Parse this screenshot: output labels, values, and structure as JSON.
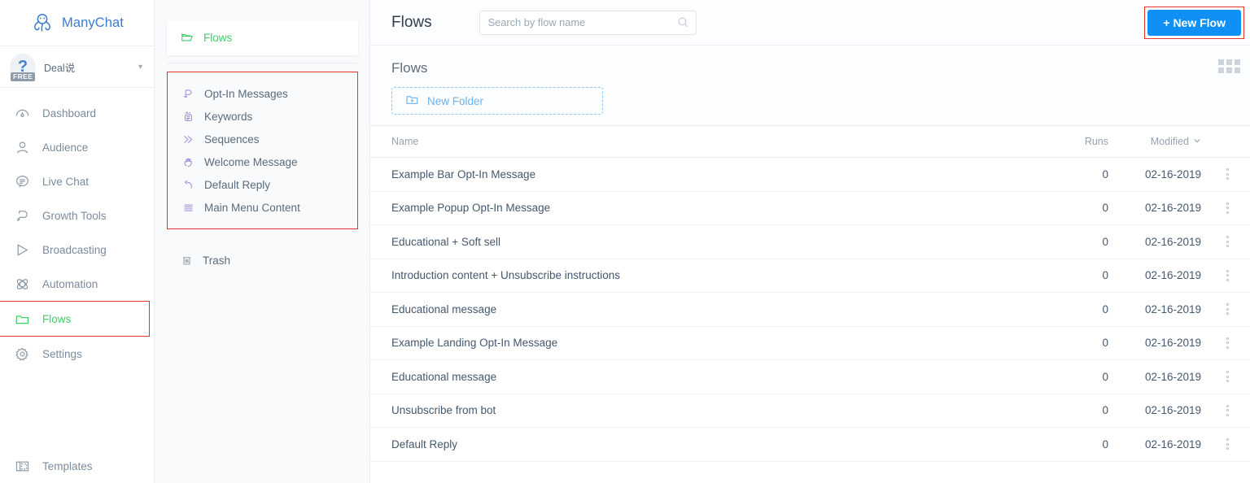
{
  "brand": {
    "name": "ManyChat",
    "logo_icon": "manychat-octopus-logo"
  },
  "account": {
    "name": "Deal说",
    "plan_badge": "FREE",
    "avatar_icon": "user-avatar",
    "chevron_icon": "chevron-down-icon"
  },
  "sidebar": {
    "items": [
      {
        "label": "Dashboard",
        "icon": "dashboard-icon",
        "active": false
      },
      {
        "label": "Audience",
        "icon": "person-icon",
        "active": false
      },
      {
        "label": "Live Chat",
        "icon": "chat-bubble-icon",
        "active": false
      },
      {
        "label": "Growth Tools",
        "icon": "magnet-icon",
        "active": false
      },
      {
        "label": "Broadcasting",
        "icon": "send-icon",
        "active": false
      },
      {
        "label": "Automation",
        "icon": "atom-icon",
        "active": false
      },
      {
        "label": "Flows",
        "icon": "folder-icon",
        "active": true
      },
      {
        "label": "Settings",
        "icon": "gear-icon",
        "active": false
      }
    ],
    "bottom_item": {
      "label": "Templates",
      "icon": "templates-icon"
    }
  },
  "tree": {
    "root": {
      "label": "Flows",
      "icon": "folder-open-icon"
    },
    "group": [
      {
        "label": "Opt-In Messages",
        "icon": "optin-icon"
      },
      {
        "label": "Keywords",
        "icon": "keywords-icon"
      },
      {
        "label": "Sequences",
        "icon": "sequences-icon"
      },
      {
        "label": "Welcome Message",
        "icon": "wave-hand-icon"
      },
      {
        "label": "Default Reply",
        "icon": "reply-arrow-icon"
      },
      {
        "label": "Main Menu Content",
        "icon": "menu-lines-icon"
      }
    ],
    "trash": {
      "label": "Trash",
      "icon": "trash-icon"
    }
  },
  "topbar": {
    "title": "Flows",
    "search": {
      "placeholder": "Search by flow name",
      "value": "",
      "icon": "search-icon"
    },
    "new_flow_label": "+ New Flow"
  },
  "content": {
    "title": "Flows",
    "new_folder_label": "New Folder",
    "new_folder_icon": "folder-plus-icon",
    "grid_view_icon": "grid-view-icon"
  },
  "table": {
    "columns": {
      "name": "Name",
      "runs": "Runs",
      "modified": "Modified"
    },
    "sort_icon": "chevron-down-icon",
    "rows": [
      {
        "name": "Example Bar Opt-In Message",
        "runs": "0",
        "modified": "02-16-2019"
      },
      {
        "name": "Example Popup Opt-In Message",
        "runs": "0",
        "modified": "02-16-2019"
      },
      {
        "name": "Educational + Soft sell",
        "runs": "0",
        "modified": "02-16-2019"
      },
      {
        "name": "Introduction content + Unsubscribe instructions",
        "runs": "0",
        "modified": "02-16-2019"
      },
      {
        "name": "Educational message",
        "runs": "0",
        "modified": "02-16-2019"
      },
      {
        "name": "Example Landing Opt-In Message",
        "runs": "0",
        "modified": "02-16-2019"
      },
      {
        "name": "Educational message",
        "runs": "0",
        "modified": "02-16-2019"
      },
      {
        "name": "Unsubscribe from bot",
        "runs": "0",
        "modified": "02-16-2019"
      },
      {
        "name": "Default Reply",
        "runs": "0",
        "modified": "02-16-2019"
      }
    ]
  },
  "colors": {
    "accent_blue": "#1090f5",
    "active_green": "#3fd06a",
    "highlight_red": "#e8322a",
    "link_blue": "#6bb2ef"
  }
}
